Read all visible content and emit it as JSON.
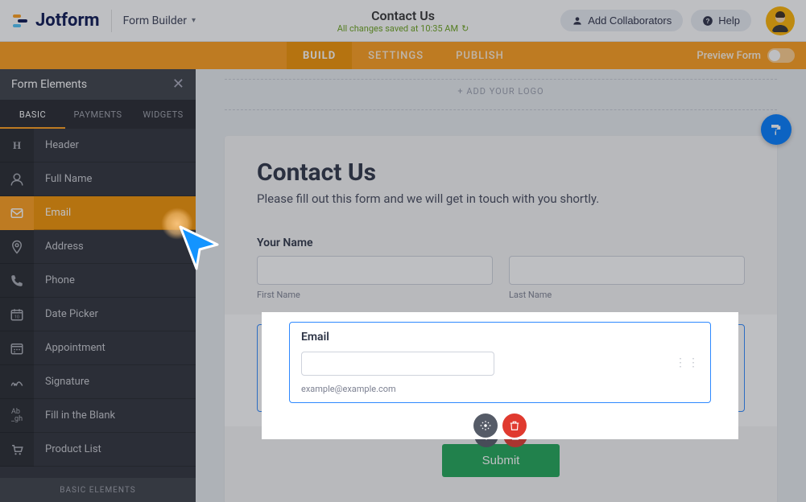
{
  "topbar": {
    "brand": "Jotform",
    "formBuilder": "Form Builder",
    "formTitle": "Contact Us",
    "saveStatus": "All changes saved at 10:35 AM",
    "addCollab": "Add Collaborators",
    "help": "Help"
  },
  "navbar": {
    "build": "BUILD",
    "settings": "SETTINGS",
    "publish": "PUBLISH",
    "preview": "Preview Form"
  },
  "sidebar": {
    "title": "Form Elements",
    "tabs": {
      "basic": "BASIC",
      "payments": "PAYMENTS",
      "widgets": "WIDGETS"
    },
    "items": [
      {
        "label": "Header",
        "icon": "header-icon"
      },
      {
        "label": "Full Name",
        "icon": "user-icon"
      },
      {
        "label": "Email",
        "icon": "email-icon"
      },
      {
        "label": "Address",
        "icon": "pin-icon"
      },
      {
        "label": "Phone",
        "icon": "phone-icon"
      },
      {
        "label": "Date Picker",
        "icon": "calendar-icon"
      },
      {
        "label": "Appointment",
        "icon": "appointment-icon"
      },
      {
        "label": "Signature",
        "icon": "signature-icon"
      },
      {
        "label": "Fill in the Blank",
        "icon": "blank-icon"
      },
      {
        "label": "Product List",
        "icon": "cart-icon"
      }
    ],
    "footer": "BASIC ELEMENTS"
  },
  "canvas": {
    "addLogo": "+ ADD YOUR LOGO",
    "headerTitle": "Contact Us",
    "headerSub": "Please fill out this form and we will get in touch with you shortly.",
    "nameLabel": "Your Name",
    "firstName": "First Name",
    "lastName": "Last Name",
    "emailLabel": "Email",
    "emailHint": "example@example.com",
    "submit": "Submit"
  }
}
